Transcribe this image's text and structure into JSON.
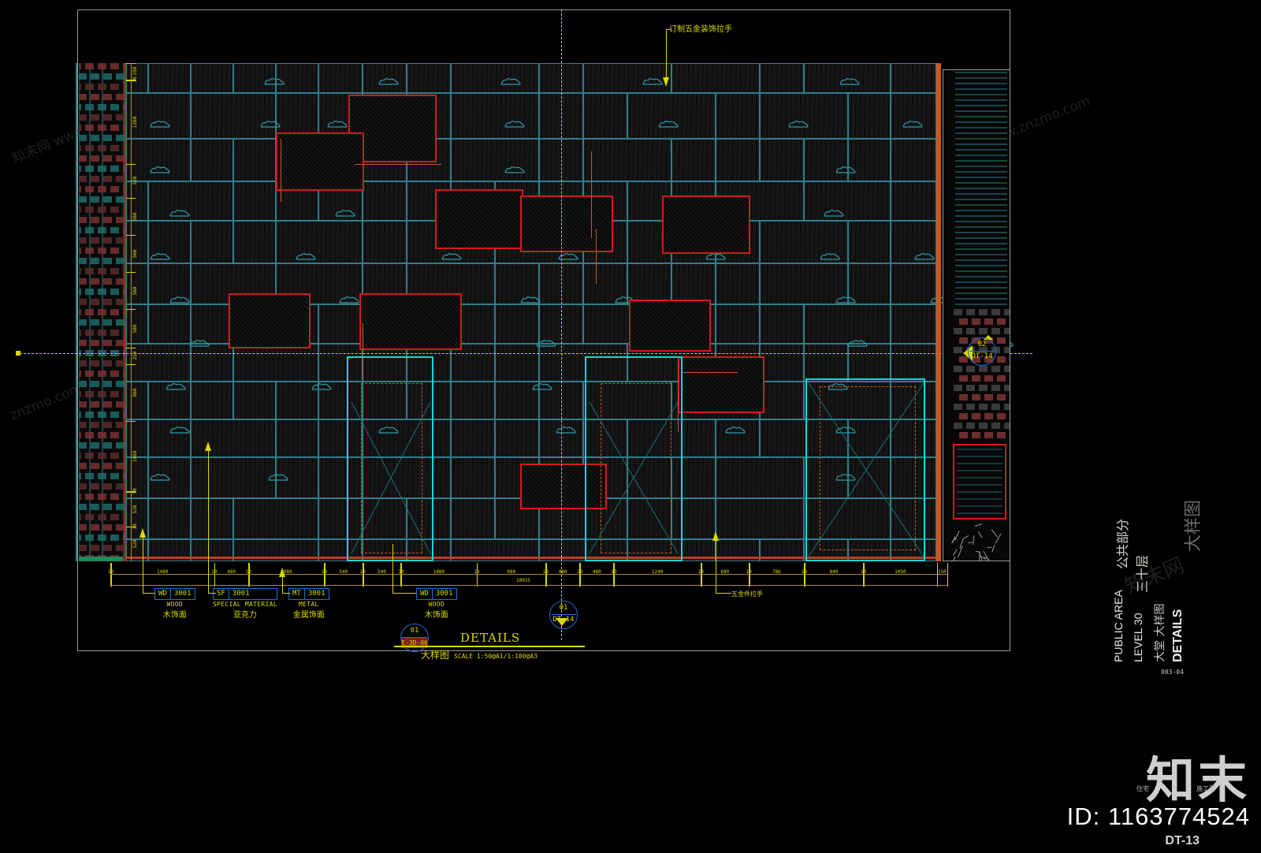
{
  "drawing": {
    "top_note": "订制五金装饰拉手",
    "handle_note_bottom": "五金件拉手",
    "detail_title_en": "DETAILS",
    "detail_title_cn": "大样图",
    "detail_scale": "SCALE 1:50@A1/1:100@A3",
    "detail_bubble_top": "01",
    "detail_bubble_bottom": "E-3D-06",
    "ref_bubble_right_top": "02",
    "ref_bubble_right_bottom": "DT-14",
    "ref_bubble_mid_top": "01",
    "ref_bubble_mid_bottom": "DT-14"
  },
  "material_tags": [
    {
      "code": "WD",
      "number": "3001",
      "en": "WOOD",
      "cn": "木饰面"
    },
    {
      "code": "SF",
      "number": "3001",
      "en": "SPECIAL MATERIAL",
      "cn": "亚克力"
    },
    {
      "code": "MT",
      "number": "3001",
      "en": "METAL",
      "cn": "金属饰面"
    },
    {
      "code": "WD",
      "number": "3001",
      "en": "WOOD",
      "cn": "木饰面"
    }
  ],
  "dimensions": {
    "overall": "10025",
    "chain": [
      "10",
      "1480",
      "10",
      "480",
      "10",
      "1080",
      "10",
      "540",
      "10",
      "540",
      "10",
      "1080",
      "10",
      "980",
      "10",
      "480",
      "10",
      "480",
      "10",
      "1240",
      "10",
      "680",
      "10",
      "786",
      "10",
      "840",
      "10",
      "1050",
      "150"
    ],
    "vertical": [
      "250",
      "10",
      "1260",
      "520",
      "560",
      "560",
      "560",
      "580",
      "250",
      "860",
      "1060",
      "10",
      "520",
      "10",
      "520"
    ]
  },
  "titleblock": {
    "line1_en": "PUBLIC AREA",
    "line1_cn": "公共部分",
    "line2_en": "LEVEL 30",
    "line2_cn": "三十层",
    "line3_cn": "大堂 大样图",
    "line4_en": "DETAILS",
    "sheet_ref": "003-04",
    "big_cn": "大样图"
  },
  "footer": {
    "logo_text": "知末",
    "logo_sub_left": "住宅",
    "logo_sub_right": "施工图",
    "id_label": "ID: 1163774524",
    "sheet": "DT-13"
  },
  "watermarks": [
    "知末网 www.znzmo.com",
    "知末网 www.znzmo.com",
    "znzmo.com",
    "知末网"
  ],
  "colors": {
    "background": "#000000",
    "yellow": "#d8d800",
    "cyan": "#12d8e0",
    "teal": "#2f7f8c",
    "red": "#d11b1b",
    "blue": "#1f6fd0",
    "orange": "#c85a1e",
    "white": "#ffffff"
  }
}
